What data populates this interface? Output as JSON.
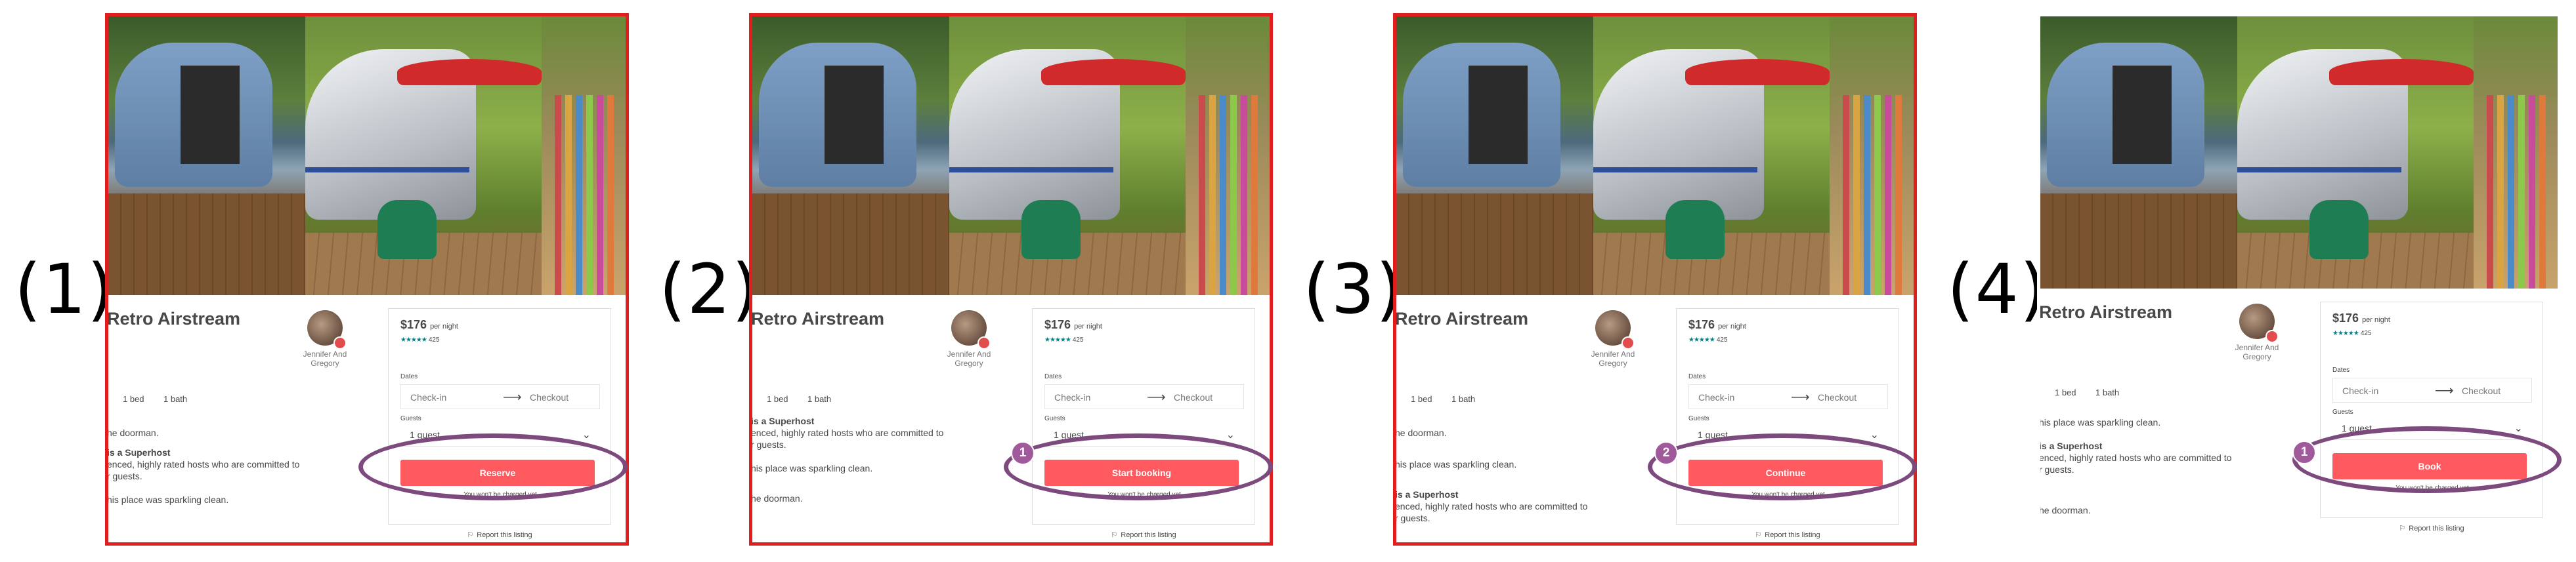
{
  "panels": [
    {
      "number_label": "(1)",
      "title": "Retro Airstream",
      "host": "Jennifer And Gregory",
      "beds": "1 bed",
      "baths": "1 bath",
      "desc_lines": [
        {
          "text": "he doorman.",
          "bold": false
        },
        {
          "text": "is a Superhost",
          "bold": true
        },
        {
          "text": "enced, highly rated hosts who are committed to",
          "bold": false
        },
        {
          "text": "r guests.",
          "bold": false
        },
        {
          "text": "his place was sparkling clean.",
          "bold": false
        }
      ],
      "card": {
        "price": "$176",
        "per_night": "per night",
        "stars": "★★★★★",
        "reviews": "425",
        "dates_label": "Dates",
        "checkin": "Check-in",
        "checkout": "Checkout",
        "guests_label": "Guests",
        "guests_value": "1 guest",
        "cta": "Reserve",
        "note": "You won't be charged yet"
      },
      "report": "Report this listing",
      "marker": null
    },
    {
      "number_label": "(2)",
      "title": "Retro Airstream",
      "host": "Jennifer And Gregory",
      "beds": "1 bed",
      "baths": "1 bath",
      "desc_lines": [
        {
          "text": "is a Superhost",
          "bold": true
        },
        {
          "text": "enced, highly rated hosts who are committed to",
          "bold": false
        },
        {
          "text": "r guests.",
          "bold": false
        },
        {
          "text": "his place was sparkling clean.",
          "bold": false
        },
        {
          "text": "he doorman.",
          "bold": false
        }
      ],
      "card": {
        "price": "$176",
        "per_night": "per night",
        "stars": "★★★★★",
        "reviews": "425",
        "dates_label": "Dates",
        "checkin": "Check-in",
        "checkout": "Checkout",
        "guests_label": "Guests",
        "guests_value": "1 guest",
        "cta": "Start booking",
        "note": "You won't be charged yet"
      },
      "report": "Report this listing",
      "marker": "1"
    },
    {
      "number_label": "(3)",
      "title": "Retro Airstream",
      "host": "Jennifer And Gregory",
      "beds": "1 bed",
      "baths": "1 bath",
      "desc_lines": [
        {
          "text": "he doorman.",
          "bold": false
        },
        {
          "text": "his place was sparkling clean.",
          "bold": false
        },
        {
          "text": "is a Superhost",
          "bold": true
        },
        {
          "text": "enced, highly rated hosts who are committed to",
          "bold": false
        },
        {
          "text": "r guests.",
          "bold": false
        }
      ],
      "card": {
        "price": "$176",
        "per_night": "per night",
        "stars": "★★★★★",
        "reviews": "425",
        "dates_label": "Dates",
        "checkin": "Check-in",
        "checkout": "Checkout",
        "guests_label": "Guests",
        "guests_value": "1 guest",
        "cta": "Continue",
        "note": "You won't be charged yet"
      },
      "report": "Report this listing",
      "marker": "2"
    },
    {
      "number_label": "(4)",
      "title": "Retro Airstream",
      "host": "Jennifer And Gregory",
      "beds": "1 bed",
      "baths": "1 bath",
      "desc_lines": [
        {
          "text": "his place was sparkling clean.",
          "bold": false
        },
        {
          "text": "is a Superhost",
          "bold": true
        },
        {
          "text": "enced, highly rated hosts who are committed to",
          "bold": false
        },
        {
          "text": "r guests.",
          "bold": false
        },
        {
          "text": "he doorman.",
          "bold": false
        }
      ],
      "card": {
        "price": "$176",
        "per_night": "per night",
        "stars": "★★★★★",
        "reviews": "425",
        "dates_label": "Dates",
        "checkin": "Check-in",
        "checkout": "Checkout",
        "guests_label": "Guests",
        "guests_value": "1 guest",
        "cta": "Book",
        "note": "You won't be charged yet"
      },
      "report": "Report this listing",
      "marker": "1"
    }
  ],
  "icons": {
    "arrow": "arrow-right-icon",
    "chevron": "chevron-down-icon",
    "flag": "flag-icon"
  },
  "colors": {
    "frame": "#e01e1e",
    "cta": "#ff5a5f",
    "annotation": "#7d4a7d",
    "marker": "#a05a9c",
    "stars": "#008489"
  }
}
